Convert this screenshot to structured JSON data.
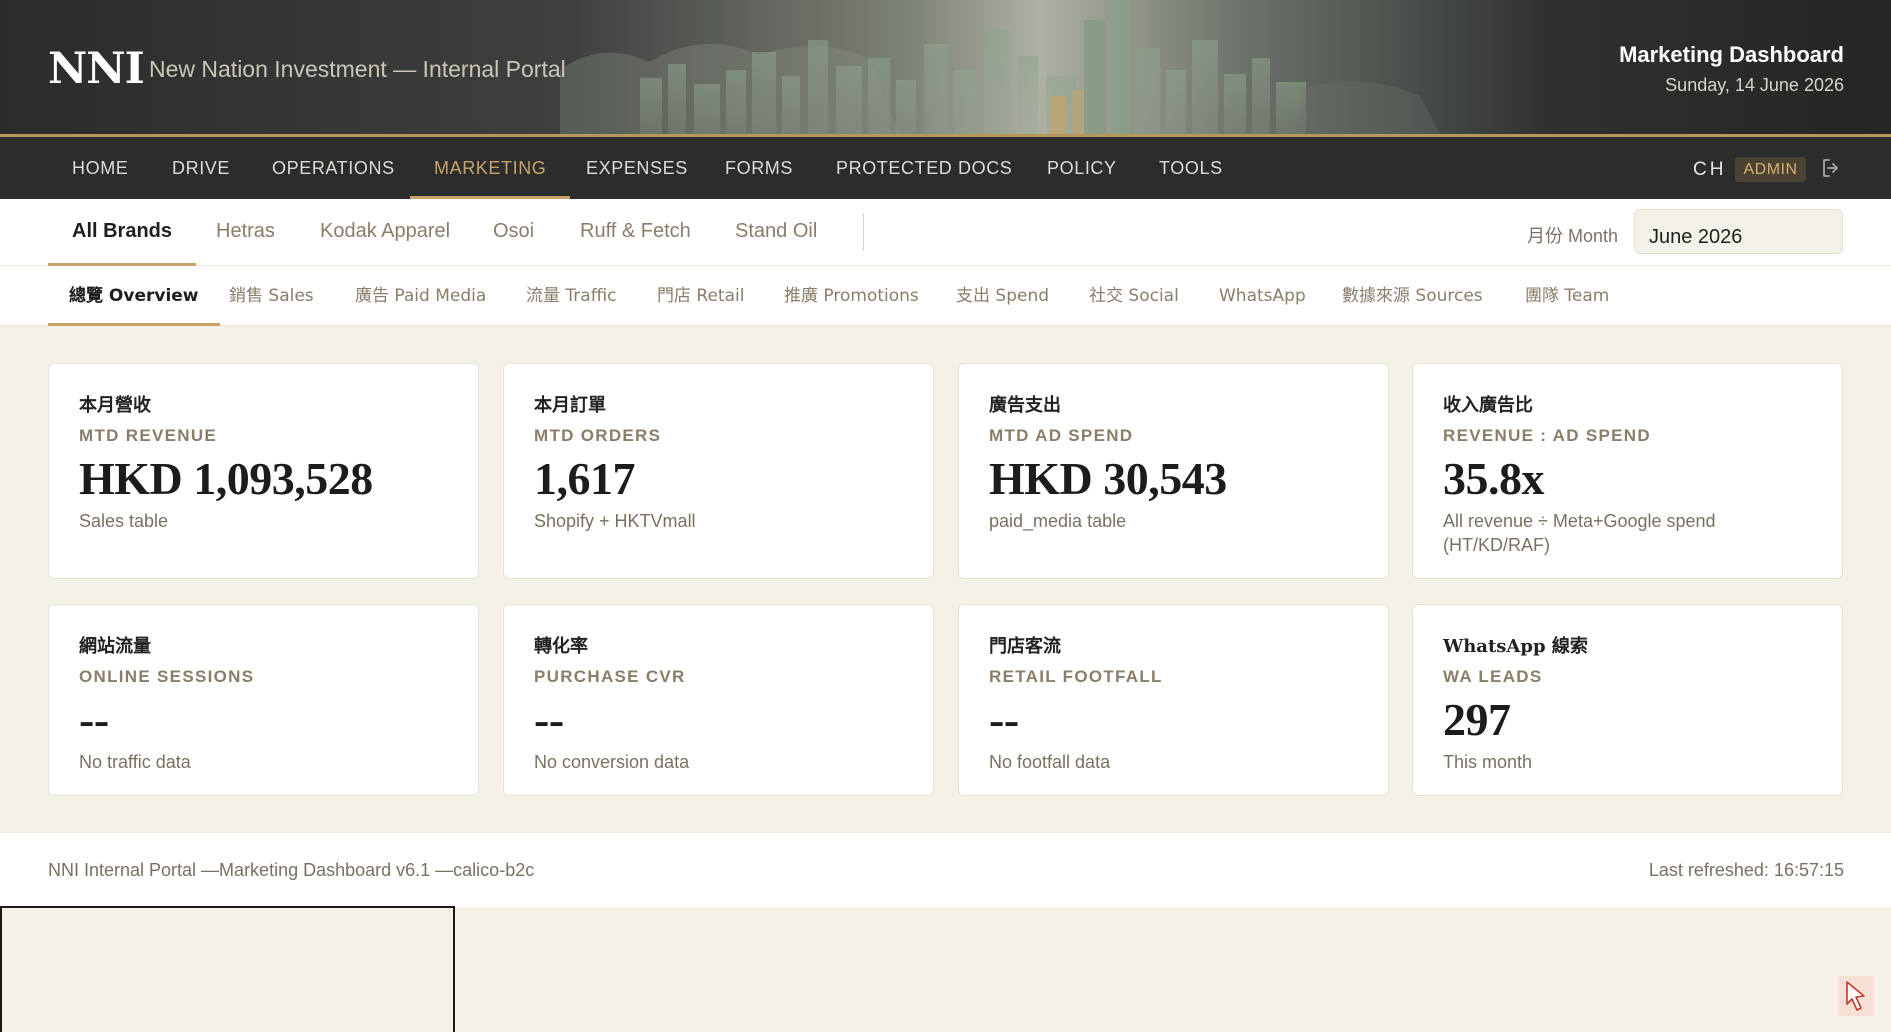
{
  "header": {
    "logo": "NNI",
    "subtitle": "New Nation Investment — Internal Portal",
    "title": "Marketing Dashboard",
    "date": "Sunday, 14 June 2026"
  },
  "nav": {
    "items": [
      "HOME",
      "DRIVE",
      "OPERATIONS",
      "MARKETING",
      "EXPENSES",
      "FORMS",
      "PROTECTED DOCS",
      "POLICY",
      "TOOLS"
    ],
    "active": "MARKETING",
    "user_initials": "CH",
    "role_badge": "ADMIN"
  },
  "brands": {
    "items": [
      "All Brands",
      "Hetras",
      "Kodak Apparel",
      "Osoi",
      "Ruff & Fetch",
      "Stand Oil"
    ],
    "active": "All Brands",
    "month_label": "月份 Month",
    "month_value": "June 2026"
  },
  "subtabs": {
    "items": [
      "總覽 Overview",
      "銷售 Sales",
      "廣告 Paid Media",
      "流量 Traffic",
      "門店 Retail",
      "推廣 Promotions",
      "支出 Spend",
      "社交 Social",
      "WhatsApp",
      "數據來源 Sources",
      "團隊 Team"
    ],
    "active": "總覽 Overview"
  },
  "cards": [
    {
      "zh": "本月營收",
      "en": "MTD REVENUE",
      "value": "HKD 1,093,528",
      "note": "Sales table"
    },
    {
      "zh": "本月訂單",
      "en": "MTD ORDERS",
      "value": "1,617",
      "note": "Shopify + HKTVmall"
    },
    {
      "zh": "廣告支出",
      "en": "MTD AD SPEND",
      "value": "HKD 30,543",
      "note": "paid_media table"
    },
    {
      "zh": "收入廣告比",
      "en": "REVENUE : AD SPEND",
      "value": "35.8x",
      "note": "All revenue ÷ Meta+Google spend (HT/KD/RAF)"
    },
    {
      "zh": "網站流量",
      "en": "ONLINE SESSIONS",
      "value": "--",
      "note": "No traffic data"
    },
    {
      "zh": "轉化率",
      "en": "PURCHASE CVR",
      "value": "--",
      "note": "No conversion data"
    },
    {
      "zh": "門店客流",
      "en": "RETAIL FOOTFALL",
      "value": "--",
      "note": "No footfall data"
    },
    {
      "zh": "WhatsApp 線索",
      "en": "WA LEADS",
      "value": "297",
      "note": "This month"
    }
  ],
  "footer": {
    "left": "NNI Internal Portal —Marketing Dashboard v6.1 —calico-b2c",
    "right": "Last refreshed: 16:57:15"
  },
  "colors": {
    "accent_gold": "#c9a267",
    "nav_bg": "#2b2d2d",
    "page_bg": "#f4f2e8"
  },
  "icons": {
    "logout": "logout-icon",
    "cursor": "cursor-icon"
  }
}
